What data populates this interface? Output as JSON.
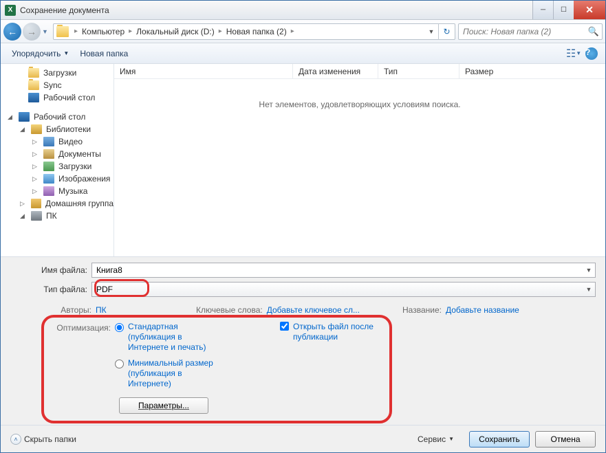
{
  "titlebar": {
    "title": "Сохранение документа"
  },
  "breadcrumb": {
    "segments": [
      "Компьютер",
      "Локальный диск (D:)",
      "Новая папка (2)"
    ]
  },
  "search": {
    "placeholder": "Поиск: Новая папка (2)"
  },
  "toolbar": {
    "organize": "Упорядочить",
    "newfolder": "Новая папка"
  },
  "columns": {
    "name": "Имя",
    "date": "Дата изменения",
    "type": "Тип",
    "size": "Размер"
  },
  "empty_message": "Нет элементов, удовлетворяющих условиям поиска.",
  "tree": {
    "downloads": "Загрузки",
    "sync": "Sync",
    "desktop1": "Рабочий стол",
    "desktop2": "Рабочий стол",
    "libraries": "Библиотеки",
    "video": "Видео",
    "documents": "Документы",
    "downloads2": "Загрузки",
    "images": "Изображения",
    "music": "Музыка",
    "homegroup": "Домашняя группа",
    "pc": "ПК"
  },
  "fields": {
    "filename_label": "Имя файла:",
    "filename_value": "Книга8",
    "filetype_label": "Тип файла:",
    "filetype_value": "PDF"
  },
  "meta": {
    "authors_label": "Авторы:",
    "authors_value": "ПК",
    "keywords_label": "Ключевые слова:",
    "keywords_value": "Добавьте ключевое сл...",
    "title_label": "Название:",
    "title_value": "Добавьте название"
  },
  "optimize": {
    "label": "Оптимизация:",
    "standard": "Стандартная (публикация в Интернете и печать)",
    "minimal": "Минимальный размер (публикация в Интернете)",
    "open_after": "Открыть файл после публикации",
    "params_btn": "Параметры..."
  },
  "footer": {
    "hide_folders": "Скрыть папки",
    "tools": "Сервис",
    "save": "Сохранить",
    "cancel": "Отмена"
  }
}
